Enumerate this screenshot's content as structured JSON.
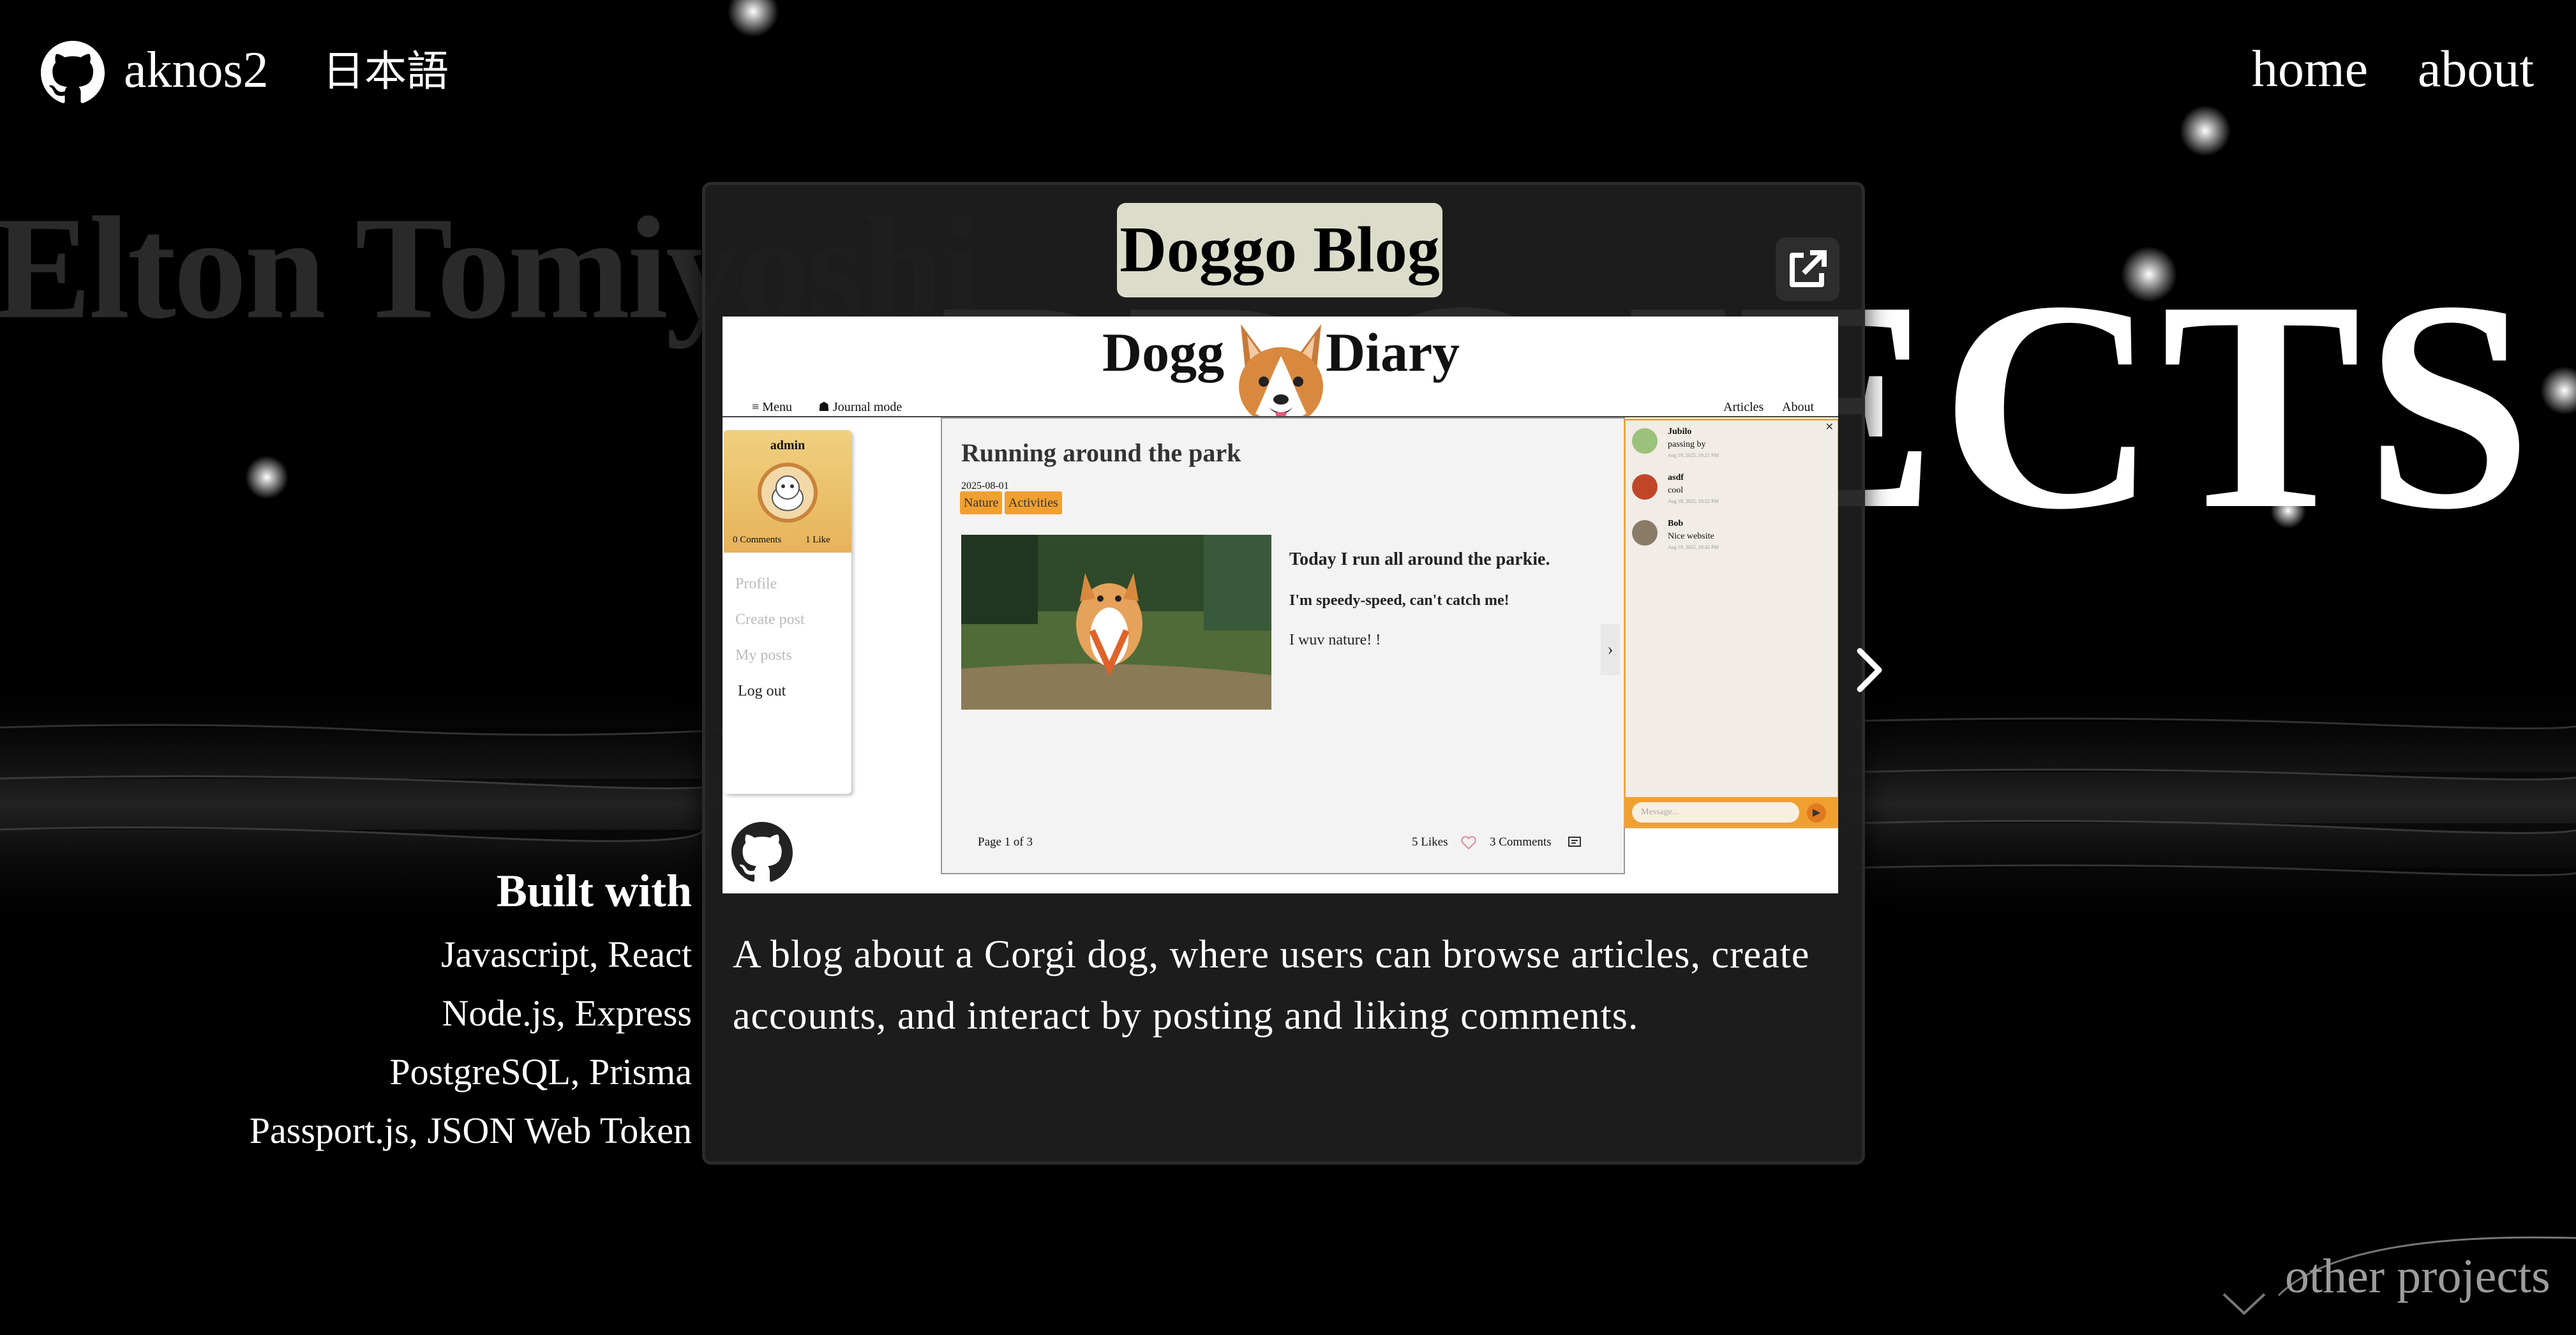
{
  "header": {
    "brand": "aknos2",
    "language_toggle": "日本語",
    "nav": {
      "home": "home",
      "about": "about"
    }
  },
  "background": {
    "name_text": "Elton Tomiyoshi",
    "section_text": "PROJECTS"
  },
  "project": {
    "title": "Doggo Blog",
    "description": "A blog about a Corgi dog, where users can browse articles, create accounts, and interact by posting and liking comments.",
    "screenshot": {
      "site_title_left": "Dogg",
      "site_title_right": "Diary",
      "menu": "≡ Menu",
      "journal_mode": "☗ Journal mode",
      "nav_articles": "Articles",
      "nav_about": "About",
      "sidebar": {
        "username": "admin",
        "comments_count": "0 Comments",
        "likes_count": "1 Like",
        "links": [
          "Profile",
          "Create post",
          "My posts",
          "Log out"
        ]
      },
      "post": {
        "title": "Running around the park",
        "date": "2025-08-01",
        "tags": [
          "Nature",
          "Activities"
        ],
        "lines": [
          "Today I run all around the parkie.",
          "I'm speedy-speed, can't catch me!",
          "I wuv nature! !"
        ],
        "pagination": "Page 1 of 3",
        "likes": "5 Likes",
        "comments": "3 Comments"
      },
      "chat": {
        "messages": [
          {
            "user": "Jubilo",
            "text": "passing by",
            "time": "Aug 19, 2025, 10:21 PM"
          },
          {
            "user": "asdf",
            "text": "cool",
            "time": "Aug 19, 2025, 10:22 PM"
          },
          {
            "user": "Bob",
            "text": "Nice website",
            "time": "Aug 19, 2025, 10:42 PM"
          }
        ],
        "placeholder": "Message..."
      }
    }
  },
  "built_with": {
    "title": "Built with",
    "items": [
      "Javascript, React",
      "Node.js, Express",
      "PostgreSQL, Prisma",
      "Passport.js, JSON Web Token"
    ]
  },
  "footer": {
    "other_projects": "other projects"
  },
  "colors": {
    "background": "#000000",
    "card": "#1e1e1e",
    "title_badge": "#dcdccb",
    "tag": "#f0a030",
    "chat_border": "#e8a845"
  },
  "icons": [
    "github-icon",
    "external-link-icon",
    "chevron-right-icon",
    "chevron-down-icon",
    "heart-icon",
    "comment-icon",
    "send-icon"
  ]
}
